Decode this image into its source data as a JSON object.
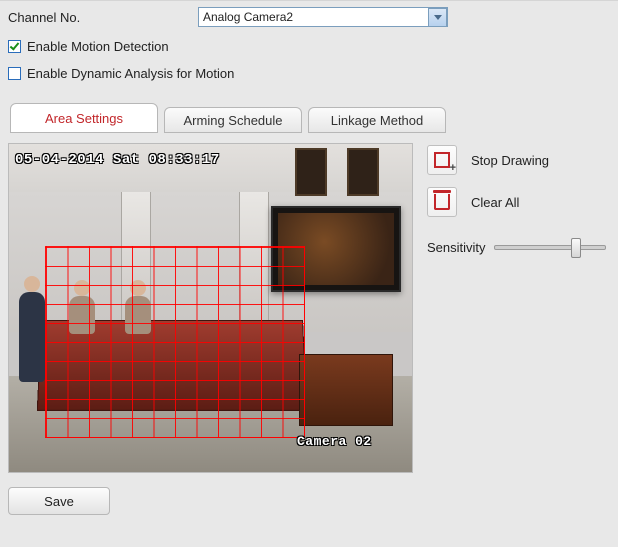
{
  "channel": {
    "label": "Channel No.",
    "selected": "Analog Camera2"
  },
  "checkboxes": {
    "motion_label": "Enable Motion Detection",
    "motion_checked": true,
    "dynamic_label": "Enable Dynamic Analysis for Motion",
    "dynamic_checked": false
  },
  "tabs": {
    "area": "Area Settings",
    "arming": "Arming Schedule",
    "linkage": "Linkage Method",
    "active": "area"
  },
  "osd": {
    "timestamp": "05-04-2014 Sat 08:33:17",
    "camera_label": "Camera 02"
  },
  "side": {
    "stop_drawing": "Stop Drawing",
    "clear_all": "Clear All",
    "sensitivity_label": "Sensitivity",
    "sensitivity_pct": 70
  },
  "buttons": {
    "save": "Save"
  }
}
